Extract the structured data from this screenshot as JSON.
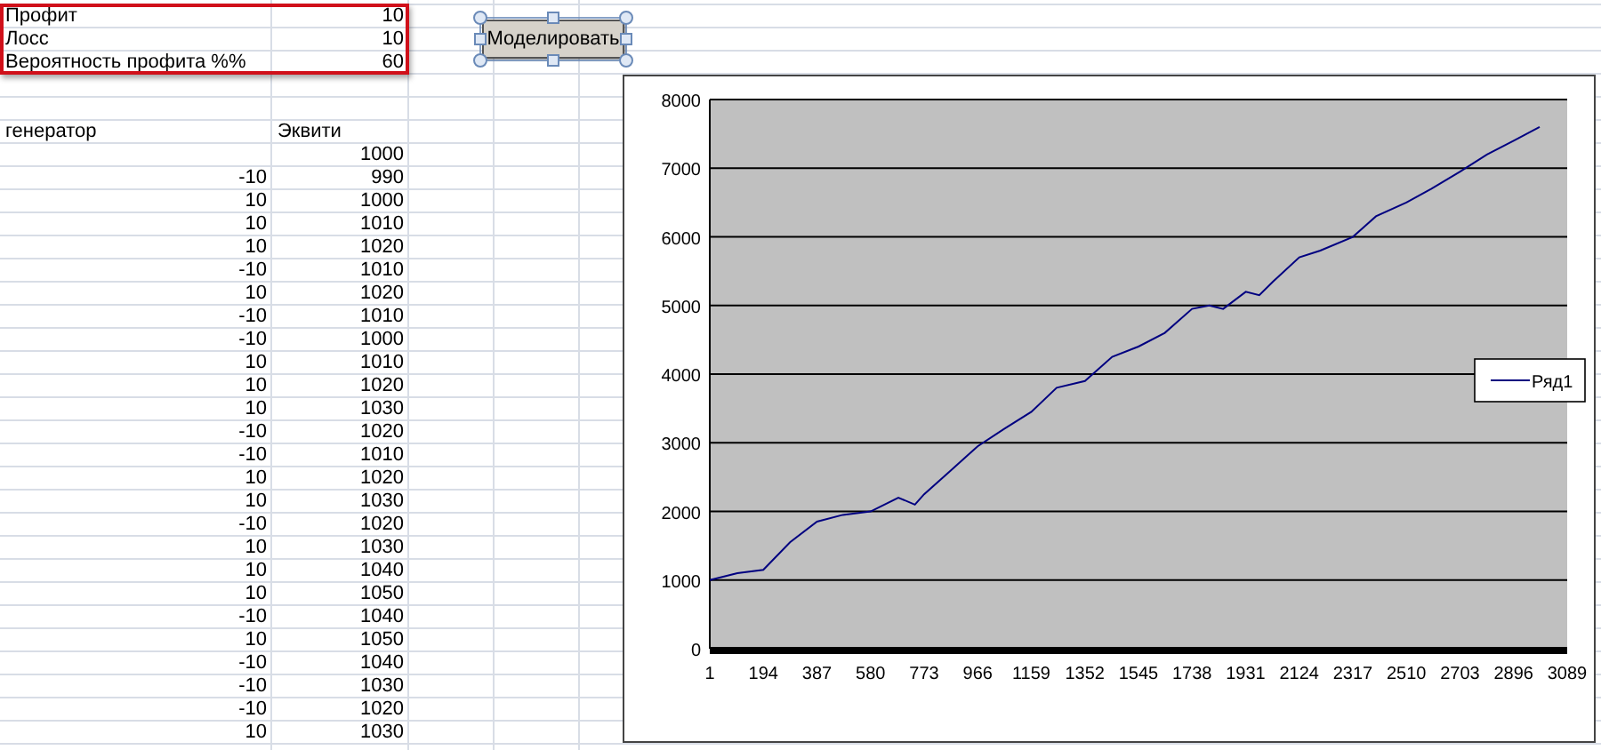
{
  "params": [
    {
      "label": "Профит",
      "value": "10"
    },
    {
      "label": "Лосс",
      "value": "10"
    },
    {
      "label": "Вероятность профита %%",
      "value": "60"
    }
  ],
  "button": {
    "label": "Моделировать",
    "selected": true
  },
  "table": {
    "columns": [
      "генератор",
      "Эквити"
    ],
    "rows": [
      {
        "equity": "1000"
      },
      {
        "generator": "-10",
        "equity": "990"
      },
      {
        "generator": "10",
        "equity": "1000"
      },
      {
        "generator": "10",
        "equity": "1010"
      },
      {
        "generator": "10",
        "equity": "1020"
      },
      {
        "generator": "-10",
        "equity": "1010"
      },
      {
        "generator": "10",
        "equity": "1020"
      },
      {
        "generator": "-10",
        "equity": "1010"
      },
      {
        "generator": "-10",
        "equity": "1000"
      },
      {
        "generator": "10",
        "equity": "1010"
      },
      {
        "generator": "10",
        "equity": "1020"
      },
      {
        "generator": "10",
        "equity": "1030"
      },
      {
        "generator": "-10",
        "equity": "1020"
      },
      {
        "generator": "-10",
        "equity": "1010"
      },
      {
        "generator": "10",
        "equity": "1020"
      },
      {
        "generator": "10",
        "equity": "1030"
      },
      {
        "generator": "-10",
        "equity": "1020"
      },
      {
        "generator": "10",
        "equity": "1030"
      },
      {
        "generator": "10",
        "equity": "1040"
      },
      {
        "generator": "10",
        "equity": "1050"
      },
      {
        "generator": "-10",
        "equity": "1040"
      },
      {
        "generator": "10",
        "equity": "1050"
      },
      {
        "generator": "-10",
        "equity": "1040"
      },
      {
        "generator": "-10",
        "equity": "1030"
      },
      {
        "generator": "-10",
        "equity": "1020"
      },
      {
        "generator": "10",
        "equity": "1030"
      }
    ]
  },
  "chart": {
    "chart_data": {
      "type": "line",
      "grid": true,
      "x": [
        1,
        100,
        194,
        290,
        387,
        480,
        580,
        680,
        740,
        773,
        870,
        966,
        1060,
        1159,
        1250,
        1352,
        1450,
        1545,
        1640,
        1738,
        1800,
        1850,
        1931,
        1980,
        2030,
        2124,
        2200,
        2317,
        2400,
        2510,
        2600,
        2703,
        2800,
        2896,
        2990
      ],
      "xlim": [
        1,
        3089
      ],
      "xticks": [
        1,
        194,
        387,
        580,
        773,
        966,
        1159,
        1352,
        1545,
        1738,
        1931,
        2124,
        2317,
        2510,
        2703,
        2896,
        3089
      ],
      "ylim": [
        0,
        8000
      ],
      "yticks": [
        0,
        1000,
        2000,
        3000,
        4000,
        5000,
        6000,
        7000,
        8000
      ],
      "series": [
        {
          "name": "Ряд1",
          "color": "#000080",
          "values": [
            1000,
            1100,
            1150,
            1550,
            1850,
            1950,
            2000,
            2200,
            2100,
            2250,
            2600,
            2950,
            3200,
            3450,
            3800,
            3900,
            4250,
            4400,
            4600,
            4950,
            5000,
            4950,
            5200,
            5150,
            5350,
            5700,
            5800,
            6000,
            6300,
            6500,
            6700,
            6950,
            7200,
            7400,
            7600
          ]
        }
      ]
    }
  }
}
